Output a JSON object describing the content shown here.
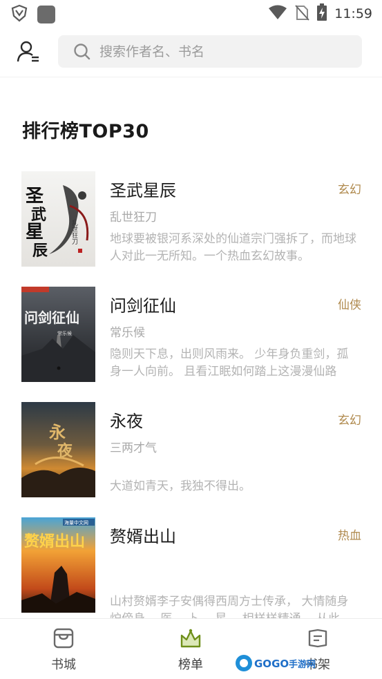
{
  "status_bar": {
    "time": "11:59"
  },
  "header": {
    "search_placeholder": "搜索作者名、书名"
  },
  "page": {
    "title": "排行榜TOP30"
  },
  "books": [
    {
      "title": "圣武星辰",
      "genre": "玄幻",
      "author": "乱世狂刀",
      "description": "地球要被银河系深处的仙道宗门强拆了，而地球人对此一无所知。一个热血玄幻故事。"
    },
    {
      "title": "问剑征仙",
      "genre": "仙侠",
      "author": "常乐候",
      "description": "隐则天下息，出则风雨来。 少年身负重剑，孤身一人向前。 且看江眠如何踏上这漫漫仙路"
    },
    {
      "title": "永夜",
      "genre": "玄幻",
      "author": "三两才气",
      "description": "大道如青天，我独不得出。"
    },
    {
      "title": "赘婿出山",
      "genre": "热血",
      "author": "",
      "description": "山村赘婿李子安偶得西周方士传承， 大情随身炉傍身， 医、 卜、 星、 相样样精通， 从此走上人生巅峰"
    }
  ],
  "covers": [
    {
      "main_text": "圣武星辰",
      "side_text": "乱世狂刀"
    },
    {
      "main_text": "问剑征仙",
      "side_text": "常乐候"
    },
    {
      "main_text": "永夜",
      "side_text": ""
    },
    {
      "main_text": "赘婿出山",
      "side_text": "海量中文网"
    }
  ],
  "bottom_nav": [
    {
      "label": "书城",
      "icon": "store-icon"
    },
    {
      "label": "榜单",
      "icon": "crown-icon"
    },
    {
      "label": "书架",
      "icon": "bookshelf-icon"
    }
  ],
  "watermark": {
    "text": "GOGO手游网"
  },
  "colors": {
    "accent_genre": "#b08a4e",
    "active_icon": "#7a9a1f"
  }
}
